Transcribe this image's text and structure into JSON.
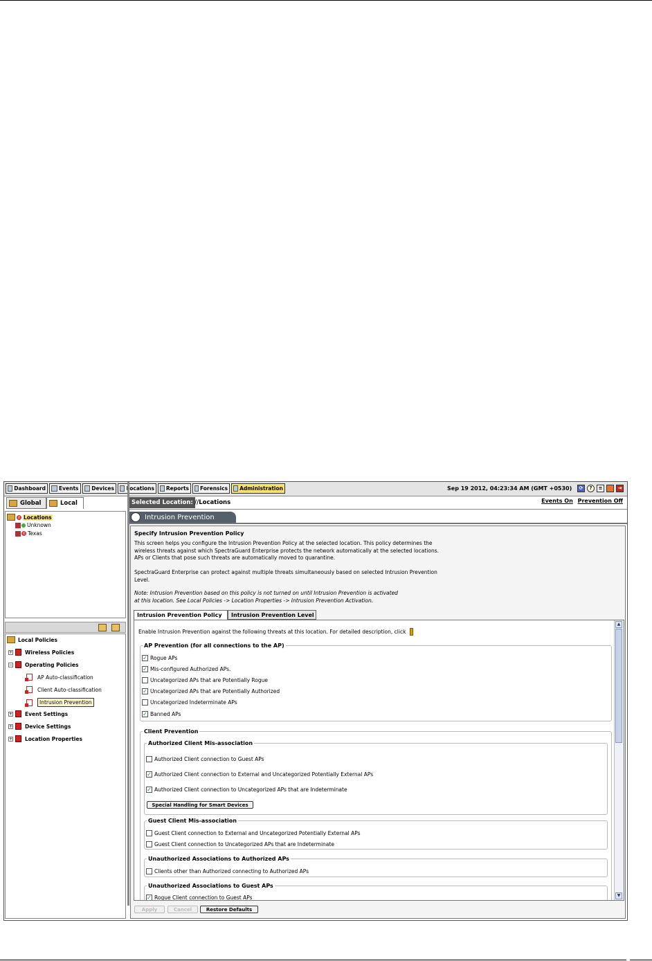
{
  "nav": {
    "items": [
      {
        "label": "Dashboard"
      },
      {
        "label": "Events"
      },
      {
        "label": "Devices"
      },
      {
        "label": "Locations"
      },
      {
        "label": "Reports"
      },
      {
        "label": "Forensics"
      },
      {
        "label": "Administration"
      }
    ],
    "datetime": "Sep 19 2012, 04:23:34 AM (GMT +0530)"
  },
  "left": {
    "tabs": [
      "Global",
      "Local"
    ],
    "tree": {
      "root": "Locations",
      "children": [
        "Unknown",
        "Texas"
      ]
    },
    "policies": {
      "root": "Local Policies",
      "items": [
        "Wireless Policies",
        "Operating Policies",
        "AP Auto-classification",
        "Client Auto-classification",
        "Intrusion Prevention",
        "Event Settings",
        "Device Settings",
        "Location Properties"
      ]
    }
  },
  "location": {
    "label": "Selected Location:",
    "value": "//Locations",
    "events_link": "Events On",
    "prevention_link": "Prevention Off"
  },
  "page": {
    "title": "Intrusion Prevention",
    "heading": "Specify Intrusion Prevention Policy",
    "desc1": [
      "This screen helps you configure the Intrusion Prevention Policy at the selected location. This policy determines the",
      "wireless threats against which SpectraGuard Enterprise protects the network automatically at the selected locations.",
      "APs or Clients that pose such threats are automatically moved to quarantine."
    ],
    "desc2": [
      "SpectraGuard Enterprise can protect against multiple threats simultaneously based on selected Intrusion Prevention",
      "Level."
    ],
    "note": [
      "Note: Intrusion Prevention based on this policy is not turned on until Intrusion Prevention is activated",
      "at this location. See Local Policies -> Location Properties -> Intrusion Prevention Activation."
    ],
    "tabs": [
      "Intrusion Prevention Policy",
      "Intrusion Prevention Level"
    ],
    "enable_text": "Enable Intrusion Prevention against the following threats at this location. For detailed description, click",
    "ap_prevention": {
      "legend": "AP Prevention (for all connections to the AP)",
      "items": [
        {
          "label": "Rogue APs",
          "checked": "✓"
        },
        {
          "label": "Mis-configured Authorized APs.",
          "checked": "✓"
        },
        {
          "label": "Uncategorized APs that are Potentially Rogue",
          "checked": ""
        },
        {
          "label": "Uncategorized APs that are Potentially Authorized",
          "checked": "✓"
        },
        {
          "label": "Uncategorized Indeterminate APs",
          "checked": ""
        },
        {
          "label": "Banned APs",
          "checked": "✓"
        }
      ]
    },
    "client_prevention": {
      "legend": "Client Prevention",
      "authorized": {
        "legend": "Authorized Client Mis-association",
        "items": [
          {
            "label": "Authorized Client connection to Guest APs",
            "checked": ""
          },
          {
            "label": "Authorized Client connection to External and Uncategorized Potentially External APs",
            "checked": "✓"
          },
          {
            "label": "Authorized Client connection to Uncategorized APs that are Indeterminate",
            "checked": "✓"
          }
        ],
        "button": "Special Handling for Smart Devices"
      },
      "guest": {
        "legend": "Guest Client Mis-association",
        "items": [
          {
            "label": "Guest Client connection to External and Uncategorized Potentially External APs",
            "checked": ""
          },
          {
            "label": "Guest Client connection to Uncategorized APs that are Indeterminate",
            "checked": ""
          }
        ]
      },
      "unauth_auth": {
        "legend": "Unauthorized Associations to Authorized APs",
        "items": [
          {
            "label": "Clients other than Authorized connecting to Authorized APs",
            "checked": ""
          }
        ]
      },
      "unauth_guest": {
        "legend": "Unauthorized Associations to Guest APs",
        "items": [
          {
            "label": "Rogue Client connection to Guest APs",
            "checked": "✓"
          }
        ]
      }
    },
    "buttons": {
      "apply": "Apply",
      "cancel": "Cancel",
      "restore": "Restore Defaults"
    }
  }
}
